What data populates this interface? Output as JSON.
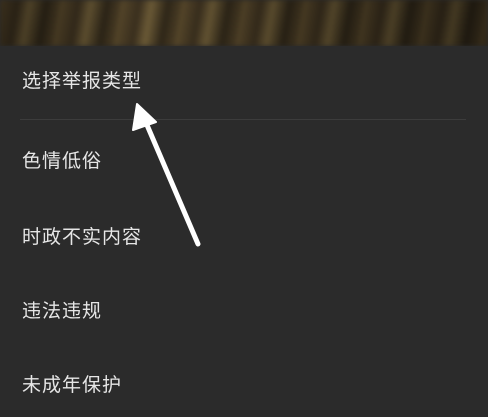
{
  "report_sheet": {
    "title": "选择举报类型",
    "options": [
      {
        "label": "色情低俗"
      },
      {
        "label": "时政不实内容"
      },
      {
        "label": "违法违规"
      },
      {
        "label": "未成年保护"
      }
    ]
  },
  "annotation": {
    "arrow_color": "#ffffff"
  },
  "colors": {
    "sheet_background": "#2b2b2b",
    "text": "#e6e6e6",
    "divider": "#3c3c3c"
  }
}
